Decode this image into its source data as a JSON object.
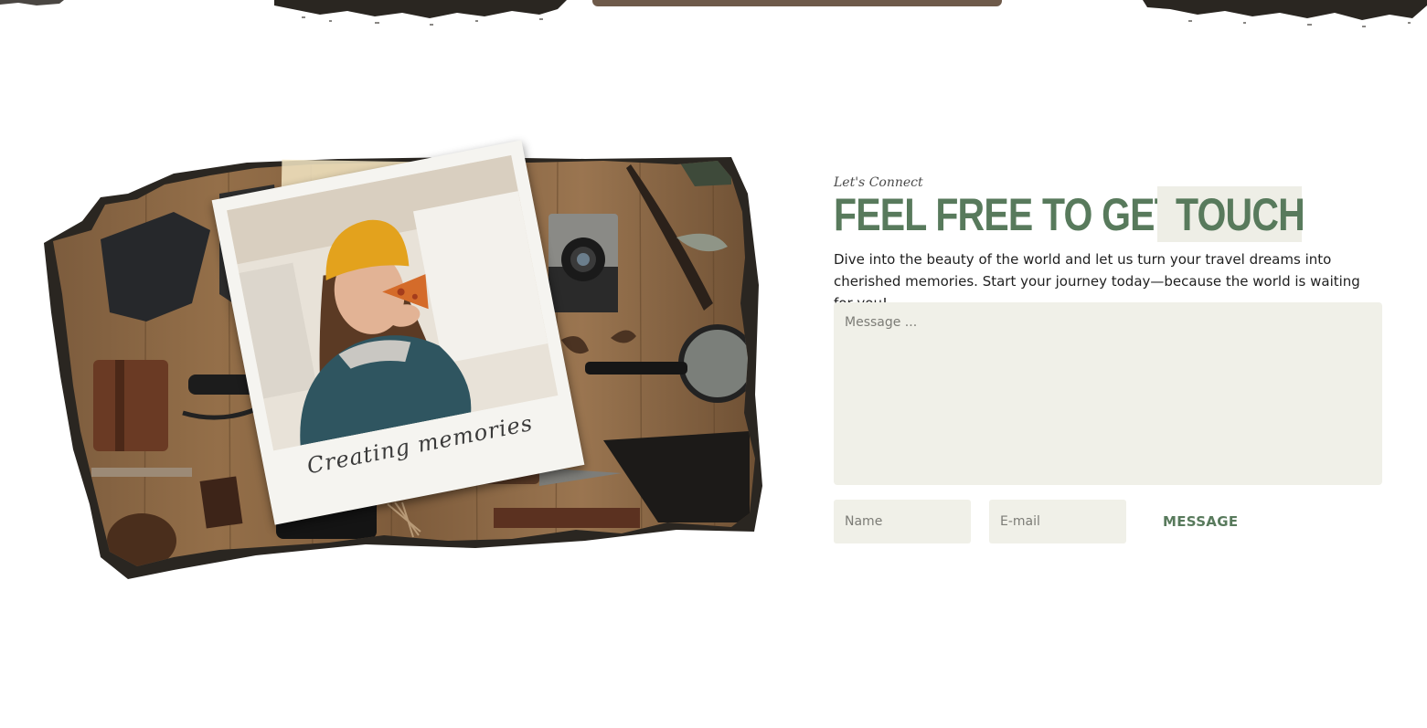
{
  "decor": {
    "brush_color": "#2a2621",
    "accent_bar_color": "#6e5a4a"
  },
  "collage": {
    "polaroid_caption": "Creating memories",
    "icons": [
      "boot-icon",
      "journal-icon",
      "flashlight-icon",
      "camera-icon",
      "feather-icon",
      "magnifier-icon",
      "knife-icon",
      "pinecone-icon",
      "binoculars-icon",
      "chocolate-icon",
      "matches-icon"
    ]
  },
  "contact": {
    "eyebrow": "Let's Connect",
    "headline_main": "FEEL FREE TO GET IN",
    "headline_highlight": "TOUCH",
    "description": "Dive into the beauty of the world and let us turn your travel dreams into cherished memories. Start your journey today—because the world is waiting for you!",
    "message_placeholder": "Message ...",
    "name_placeholder": "Name",
    "email_placeholder": "E-mail",
    "submit_label": "MESSAGE",
    "accent_color": "#587a5c",
    "field_bg": "#f0f0e8"
  }
}
